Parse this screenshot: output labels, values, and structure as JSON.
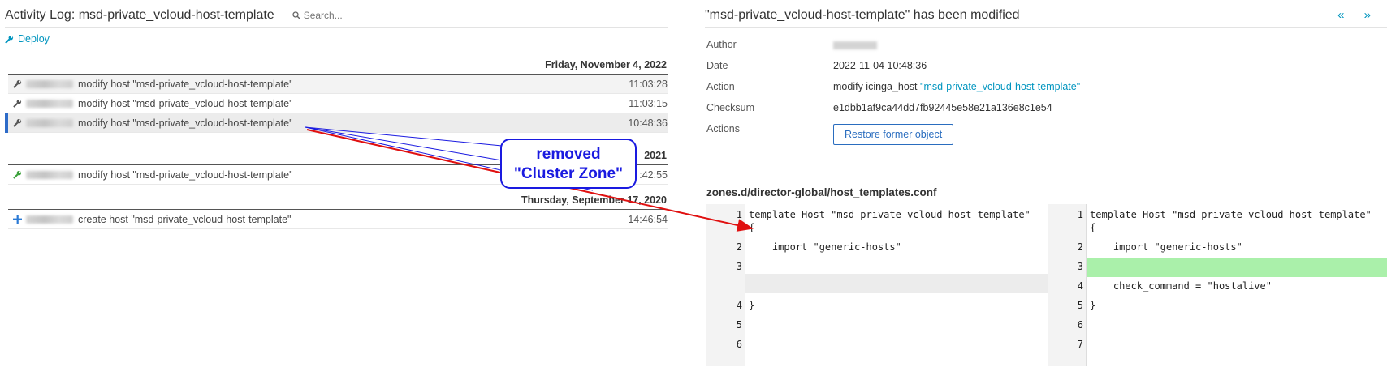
{
  "header": {
    "title": "Activity Log: msd-private_vcloud-host-template",
    "search_placeholder": "Search..."
  },
  "toolbar": {
    "deploy_label": "Deploy"
  },
  "days": [
    {
      "label": "Friday, November 4, 2022",
      "rows": [
        {
          "message": "modify host \"msd-private_vcloud-host-template\"",
          "time": "11:03:28",
          "icon": "wrench-icon"
        },
        {
          "message": "modify host \"msd-private_vcloud-host-template\"",
          "time": "11:03:15",
          "icon": "wrench-icon"
        },
        {
          "message": "modify host \"msd-private_vcloud-host-template\"",
          "time": "10:48:36",
          "icon": "wrench-icon"
        }
      ]
    },
    {
      "label": "2021",
      "rows": [
        {
          "message": "modify host \"msd-private_vcloud-host-template\"",
          "time": ":42:55",
          "icon": "wrench-icon"
        }
      ]
    },
    {
      "label": "Thursday, September 17, 2020",
      "rows": [
        {
          "message": "create host \"msd-private_vcloud-host-template\"",
          "time": "14:46:54",
          "icon": "plus-icon"
        }
      ]
    }
  ],
  "annotation": {
    "line1": "removed",
    "line2": "\"Cluster Zone\""
  },
  "detail": {
    "title": "\"msd-private_vcloud-host-template\" has been modified",
    "nav": "« »",
    "labels": {
      "author": "Author",
      "date": "Date",
      "action": "Action",
      "checksum": "Checksum",
      "actions": "Actions"
    },
    "date": "2022-11-04 10:48:36",
    "action_prefix": "modify icinga_host",
    "action_link": "\"msd-private_vcloud-host-template\"",
    "checksum": "e1dbb1af9ca44dd7fb92445e58e21a136e8c1e54",
    "restore_label": "Restore former object",
    "filename": "zones.d/director-global/host_templates.conf"
  },
  "diff_left": [
    {
      "num": "1",
      "code": "template Host \"msd-private_vcloud-host-template\""
    },
    {
      "num": "",
      "code": "{"
    },
    {
      "num": "2",
      "code": "    import \"generic-hosts\""
    },
    {
      "num": "3",
      "code": ""
    },
    {
      "num": "4",
      "code": "}"
    },
    {
      "num": "5",
      "code": ""
    },
    {
      "num": "6",
      "code": ""
    }
  ],
  "diff_right": [
    {
      "num": "1",
      "code": "template Host \"msd-private_vcloud-host-template\""
    },
    {
      "num": "",
      "code": "{"
    },
    {
      "num": "2",
      "code": "    import \"generic-hosts\""
    },
    {
      "num": "3",
      "code": ""
    },
    {
      "num": "4",
      "code": "    check_command = \"hostalive\""
    },
    {
      "num": "5",
      "code": "}"
    },
    {
      "num": "6",
      "code": ""
    },
    {
      "num": "7",
      "code": ""
    }
  ],
  "colors": {
    "accent": "#0095bf",
    "callout": "#1a1ae0",
    "arrow": "#e01010",
    "added": "#aaf0aa"
  }
}
